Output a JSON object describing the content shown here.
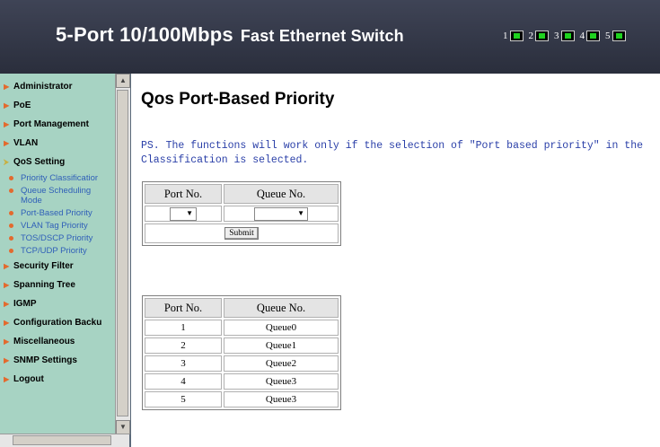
{
  "header": {
    "title_main": "5-Port 10/100Mbps",
    "title_sub": "Fast Ethernet Switch",
    "ports": [
      "1",
      "2",
      "3",
      "4",
      "5"
    ]
  },
  "sidebar": {
    "items": [
      {
        "label": "Administrator"
      },
      {
        "label": "PoE"
      },
      {
        "label": "Port Management"
      },
      {
        "label": "VLAN"
      },
      {
        "label": "QoS Setting"
      },
      {
        "label": "Security Filter"
      },
      {
        "label": "Spanning Tree"
      },
      {
        "label": "IGMP"
      },
      {
        "label": "Configuration Backu"
      },
      {
        "label": "Miscellaneous"
      },
      {
        "label": "SNMP Settings"
      },
      {
        "label": "Logout"
      }
    ],
    "qos_sub": [
      "Priority Classificatior",
      "Queue Scheduling Mode",
      "Port-Based Priority",
      "VLAN Tag Priority",
      "TOS/DSCP Priority",
      "TCP/UDP Priority"
    ]
  },
  "main": {
    "title": "Qos Port-Based Priority",
    "note_line1": "PS. The functions will work only if the selection of \"Port based priority\" in the",
    "note_line2": "Classification is selected.",
    "config": {
      "col_port": "Port No.",
      "col_queue": "Queue No.",
      "port_value": "",
      "queue_value": "",
      "submit": "Submit"
    },
    "table": {
      "col_port": "Port No.",
      "col_queue": "Queue No.",
      "rows": [
        {
          "port": "1",
          "queue": "Queue0"
        },
        {
          "port": "2",
          "queue": "Queue1"
        },
        {
          "port": "3",
          "queue": "Queue2"
        },
        {
          "port": "4",
          "queue": "Queue3"
        },
        {
          "port": "5",
          "queue": "Queue3"
        }
      ]
    }
  }
}
